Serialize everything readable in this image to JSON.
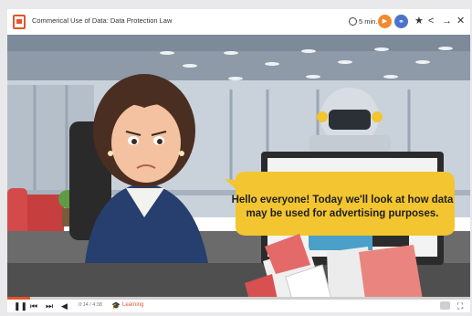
{
  "topbar": {
    "title": "Commerical Use of Data: Data Protection Law",
    "duration": "5 min."
  },
  "scene": {
    "speech": "Hello everyone! Today we'll look at how data may be used for advertising purposes."
  },
  "player": {
    "time": "0:14 / 4:38",
    "progress": 0.05,
    "mode_label": "Learning"
  },
  "colors": {
    "accent": "#e0552b",
    "play": "#f08a2d",
    "share": "#4a74c9",
    "bubble": "#f2c531"
  }
}
